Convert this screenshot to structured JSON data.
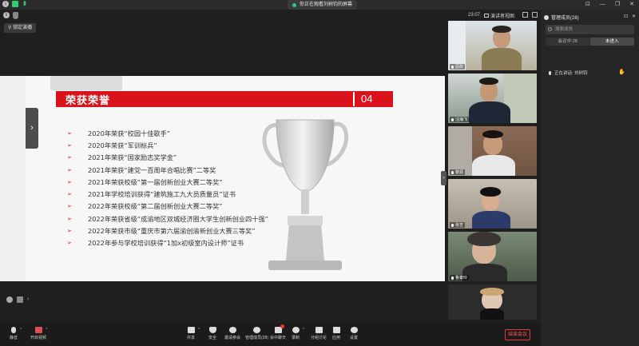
{
  "titlebar": {
    "share_notice": "你正在观看刘树钧的屏幕",
    "window_controls": [
      "⊡",
      "—",
      "❐",
      "✕"
    ]
  },
  "topbar": {
    "time": "23:07",
    "view_label": "演讲者视图",
    "lock_label": "锁定演播"
  },
  "slide": {
    "title": "荣获荣誉",
    "number": "04",
    "honors": [
      "2020年荣获“校园十佳歌手”",
      "2020年荣获“军训标兵”",
      "2021年荣获“国家励志奖学金”",
      "2021年荣获“建党一百周年合唱比赛”二等奖",
      "2021年荣获校级“第一届创新创业大赛二等奖”",
      "2021年学校培训获得“建筑施工九大员质量员”证书",
      "2022年荣获校级“第二届创新创业大赛二等奖”",
      "2022年荣获省级“成渝地区双城经济圈大学生创新创业四十强”",
      "2022年荣获市级“重庆市第六届渝创渝新创业大赛三等奖”",
      "2022年参与学校培训获得“1加x初级室内设计师”证书"
    ],
    "arrow_glyph": "➢",
    "accent_color": "#d9121b"
  },
  "videos": [
    {
      "name": "屈政"
    },
    {
      "name": "汪海飞"
    },
    {
      "name": "黎源"
    },
    {
      "name": "张吉"
    },
    {
      "name": "鲁秦玲"
    },
    {
      "name": ""
    }
  ],
  "panel": {
    "title": "管理成员(28)",
    "search_placeholder": "搜索成员",
    "tabs": [
      "会议中·28",
      "未进入"
    ],
    "speaking_label": "正在讲话: 刘树钧"
  },
  "toolbar": {
    "buttons": [
      "静音",
      "开启视频",
      "共享",
      "安全",
      "邀请参会",
      "管理成员(28)",
      "会中聊天",
      "录制",
      "分组讨论",
      "应用",
      "设置"
    ],
    "end_label": "结束会议"
  }
}
